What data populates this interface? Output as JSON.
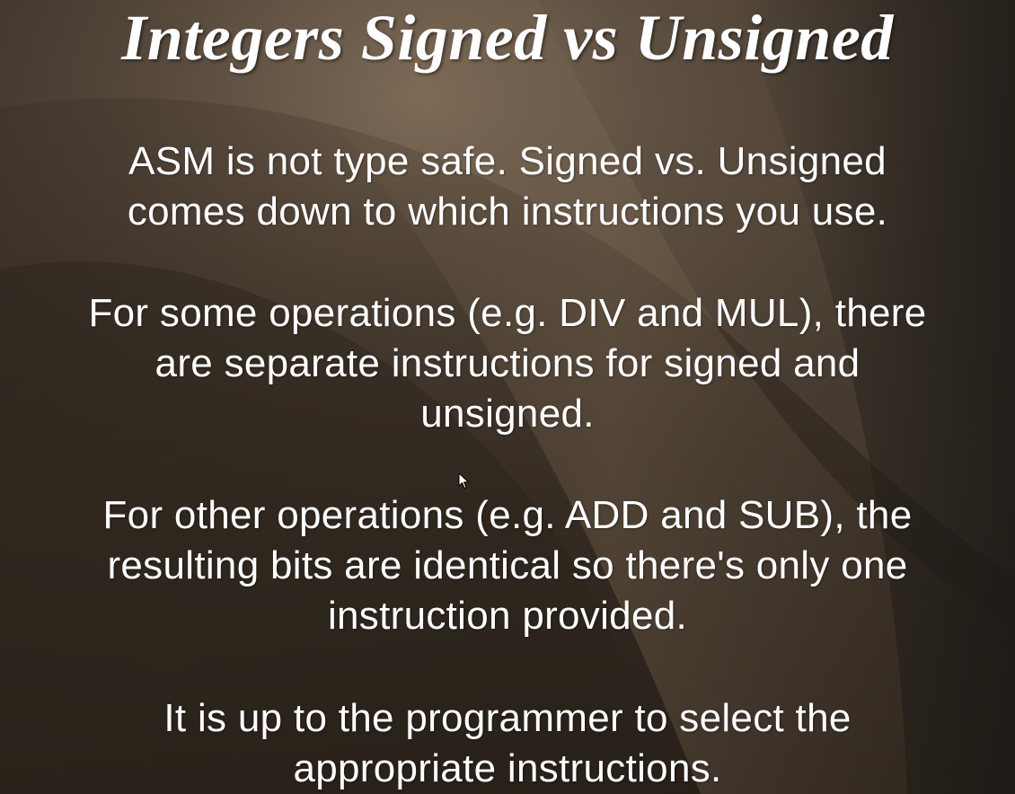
{
  "slide": {
    "title": "Integers Signed vs Unsigned",
    "paragraphs": [
      {
        "lines": [
          "ASM is not type safe. Signed vs. Unsigned",
          "comes down to which instructions you use."
        ]
      },
      {
        "lines": [
          "For some operations (e.g. DIV and MUL), there",
          "are separate instructions for signed and",
          "unsigned."
        ]
      },
      {
        "lines": [
          "For other operations (e.g. ADD and SUB), the",
          "resulting bits are identical so there's only one",
          "instruction provided."
        ]
      },
      {
        "lines": [
          "It is up to the programmer to select the",
          "appropriate instructions."
        ]
      }
    ]
  },
  "colors": {
    "background_dark": "#2c241d",
    "background_light": "#6b5a48",
    "text": "#ffffff"
  },
  "icons": {
    "cursor": "mouse-pointer-icon"
  }
}
